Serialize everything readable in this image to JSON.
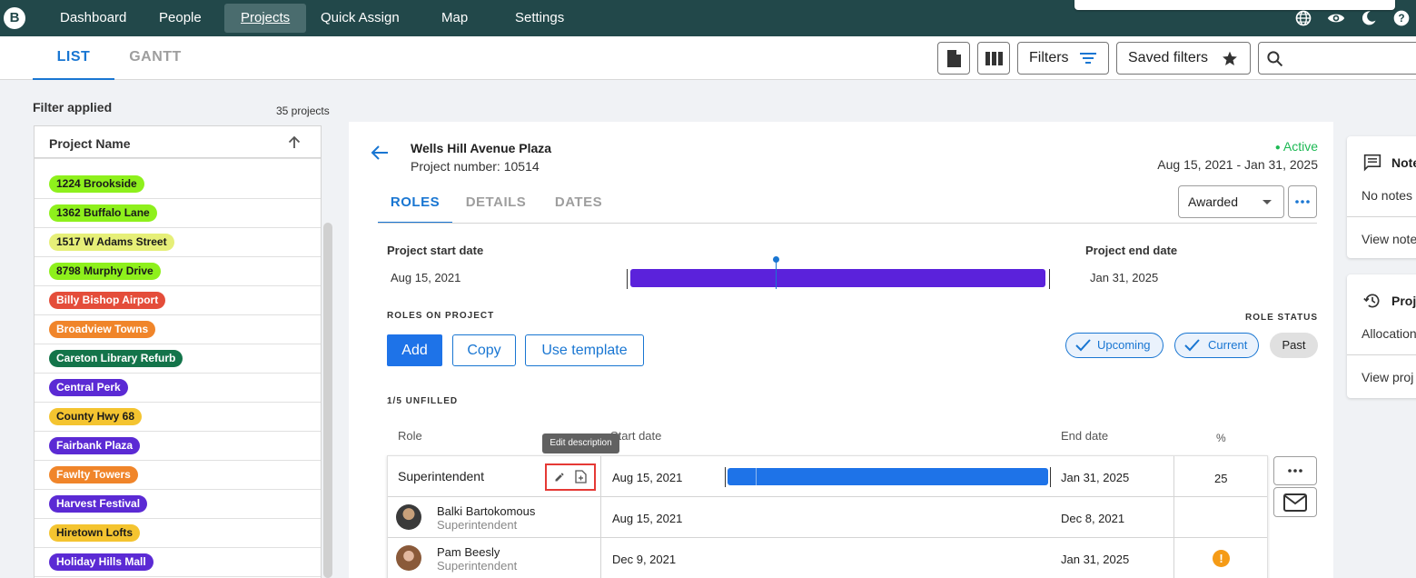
{
  "nav": {
    "logo": "B",
    "items": [
      "Dashboard",
      "People",
      "Projects",
      "Quick Assign",
      "Map",
      "Settings"
    ],
    "active": "Projects"
  },
  "subheader": {
    "tabs": [
      "LIST",
      "GANTT"
    ],
    "filters_label": "Filters",
    "saved_filters_label": "Saved filters"
  },
  "left": {
    "filter_applied": "Filter applied",
    "project_count": "35 projects",
    "column_header": "Project Name",
    "projects": [
      {
        "name": "1224 Brookside",
        "color": "#8ef01c"
      },
      {
        "name": "1362 Buffalo Lane",
        "color": "#8ef01c"
      },
      {
        "name": "1517 W Adams Street",
        "color": "#e6ef78"
      },
      {
        "name": "8798 Murphy Drive",
        "color": "#8ef01c"
      },
      {
        "name": "Billy Bishop Airport",
        "color": "#e44d3a"
      },
      {
        "name": "Broadview Towns",
        "color": "#f0852a"
      },
      {
        "name": "Careton Library Refurb",
        "color": "#13744a"
      },
      {
        "name": "Central Perk",
        "color": "#5b2ad4"
      },
      {
        "name": "County Hwy 68",
        "color": "#f4c430"
      },
      {
        "name": "Fairbank Plaza",
        "color": "#5b2ad4"
      },
      {
        "name": "Fawlty Towers",
        "color": "#f0852a"
      },
      {
        "name": "Harvest Festival",
        "color": "#5b2ad4"
      },
      {
        "name": "Hiretown Lofts",
        "color": "#f4c430"
      },
      {
        "name": "Holiday Hills Mall",
        "color": "#5b2ad4"
      }
    ]
  },
  "project": {
    "name": "Wells Hill Avenue Plaza",
    "number": "Project number: 10514",
    "status": "Active",
    "date_range": "Aug 15, 2021 - Jan 31, 2025",
    "tabs": [
      "ROLES",
      "DETAILS",
      "DATES"
    ],
    "stage": "Awarded",
    "start_label": "Project start date",
    "start_date": "Aug 15, 2021",
    "end_label": "Project end date",
    "end_date": "Jan 31, 2025",
    "roles_on_project": "ROLES ON PROJECT",
    "role_status": "ROLE STATUS",
    "add_label": "Add",
    "copy_label": "Copy",
    "template_label": "Use template",
    "status_filters": [
      "Upcoming",
      "Current",
      "Past"
    ],
    "unfilled": "1/5 UNFILLED",
    "columns": {
      "role": "Role",
      "start": "Start date",
      "end": "End date",
      "pct": "%"
    },
    "tooltip": "Edit description",
    "role": {
      "name": "Superintendent",
      "start": "Aug 15, 2021",
      "end": "Jan 31, 2025",
      "pct": "25"
    },
    "people": [
      {
        "name": "Balki Bartokomous",
        "role": "Superintendent",
        "start": "Aug 15, 2021",
        "end": "Dec 8, 2021",
        "warning": false
      },
      {
        "name": "Pam Beesly",
        "role": "Superintendent",
        "start": "Dec 9, 2021",
        "end": "Jan 31, 2025",
        "warning": true
      }
    ]
  },
  "right": {
    "notes_title": "Note",
    "no_notes": "No notes",
    "view_notes": "View note",
    "history_title": "Proj",
    "allocation": "Allocation",
    "view_project": "View proj"
  },
  "colors": {
    "nav_bg": "#22484a",
    "accent": "#1976d2",
    "project_bar": "#5b22db",
    "role_bar": "#1e73e8",
    "active_status": "#1db954",
    "warning": "#f59b16",
    "highlight_box": "#e53935"
  }
}
